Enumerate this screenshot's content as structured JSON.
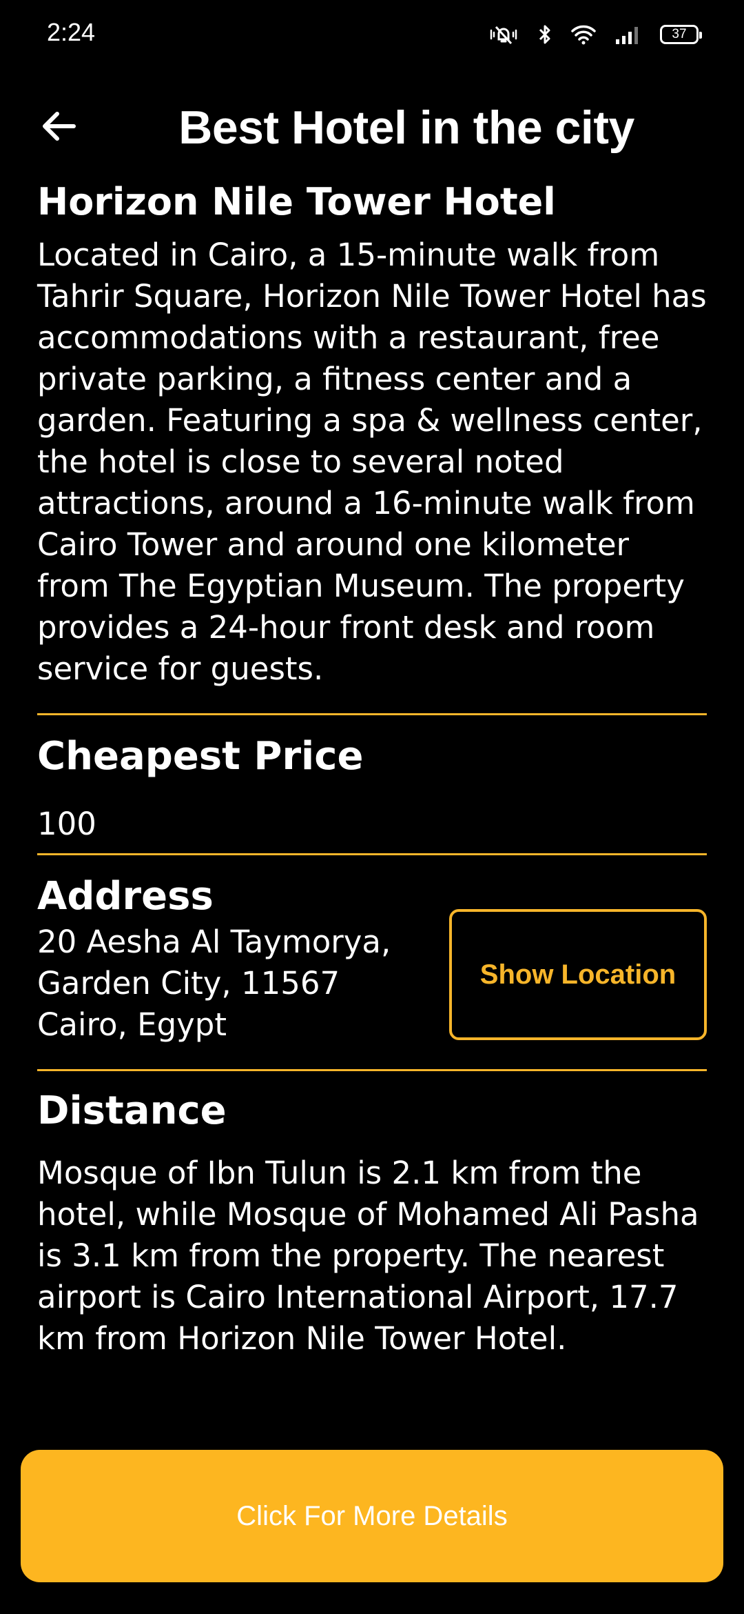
{
  "status_bar": {
    "time": "2:24",
    "battery": "37",
    "icons": [
      "mute-vibrate-icon",
      "bluetooth-icon",
      "wifi-icon",
      "signal-icon",
      "battery-icon"
    ]
  },
  "header": {
    "title": "Best Hotel in the city",
    "back_icon": "arrow-left-icon"
  },
  "hotel": {
    "name": "Horizon Nile Tower Hotel",
    "description": "Located in Cairo, a 15-minute walk from Tahrir Square, Horizon Nile Tower Hotel has accommodations with a restaurant, free private parking, a fitness center and a garden. Featuring a spa & wellness center, the hotel is close to several noted attractions, around a 16-minute walk from Cairo Tower and around one kilometer from The Egyptian Museum. The property provides a 24-hour front desk and room service for guests."
  },
  "price": {
    "heading": "Cheapest Price",
    "value": "100"
  },
  "address": {
    "heading": "Address",
    "line1": "20 Aesha Al Taymorya,",
    "line2": "Garden City, 11567",
    "line3": "Cairo, Egypt",
    "button_label": "Show Location"
  },
  "distance": {
    "heading": "Distance",
    "text": "Mosque of Ibn Tulun is 2.1 km from the hotel, while Mosque of Mohamed Ali Pasha is 3.1 km from the property. The nearest airport is Cairo International Airport, 17.7 km from Horizon Nile Tower Hotel."
  },
  "footer": {
    "button_label": "Click For More Details"
  },
  "colors": {
    "background": "#000000",
    "accent": "#f7b52a",
    "button_fill": "#fdb620",
    "text": "#ffffff"
  }
}
